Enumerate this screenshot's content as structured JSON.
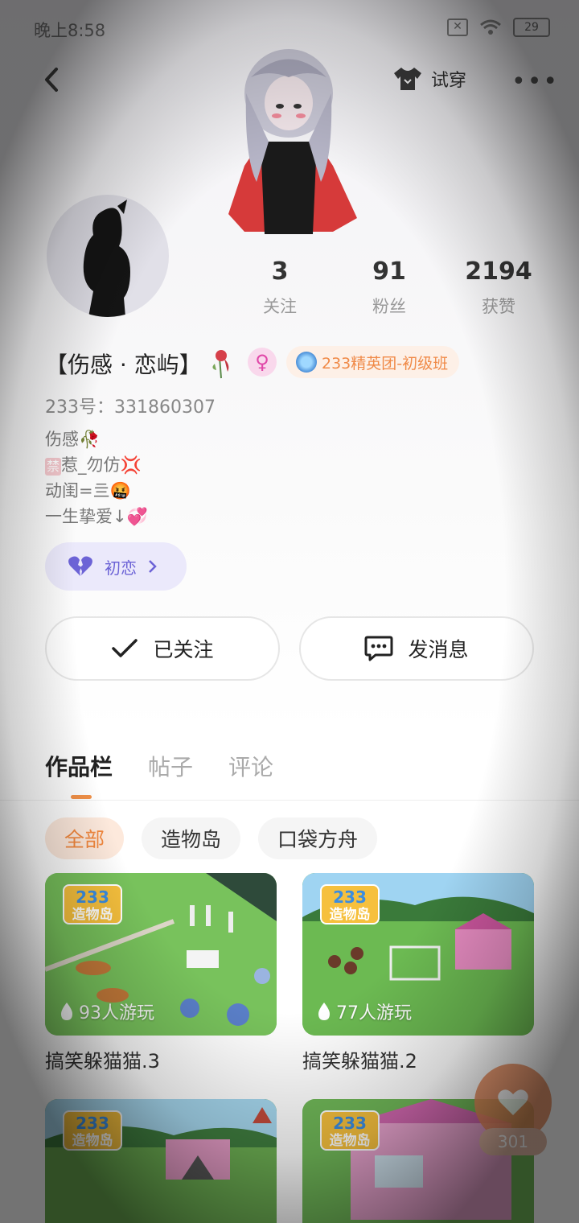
{
  "status_bar": {
    "time": "晚上8:58",
    "battery": "29"
  },
  "header": {
    "try_on_label": "试穿",
    "more_label": "•••"
  },
  "stats": [
    {
      "value": "3",
      "label": "关注"
    },
    {
      "value": "91",
      "label": "粉丝"
    },
    {
      "value": "2194",
      "label": "获赞"
    }
  ],
  "profile": {
    "name": "【伤感 · 恋屿】",
    "gender_symbol": "♀",
    "badge_label": "233精英团-初级班",
    "uid": "233号：331860307",
    "bio_lines": [
      "伤感🥀",
      "惹_勿仿💢",
      "动闺=亖🤬",
      "一生挚爱↓💞"
    ],
    "bio_tag": "禁",
    "relation_label": "初恋"
  },
  "actions": {
    "follow_label": "已关注",
    "message_label": "发消息"
  },
  "tabs": [
    {
      "label": "作品栏"
    },
    {
      "label": "帖子"
    },
    {
      "label": "评论"
    }
  ],
  "filters": [
    {
      "label": "全部"
    },
    {
      "label": "造物岛"
    },
    {
      "label": "口袋方舟"
    }
  ],
  "works": [
    {
      "title": "搞笑躲猫猫.3",
      "plays": "93人游玩"
    },
    {
      "title": "搞笑躲猫猫.2",
      "plays": "77人游玩"
    },
    {
      "title": "",
      "plays": ""
    },
    {
      "title": "",
      "plays": ""
    }
  ],
  "logo": {
    "top": "233",
    "bottom": "造物岛"
  },
  "like_fab": {
    "count": "301"
  },
  "colors": {
    "accent": "#f2883e",
    "purple": "#6c63d6",
    "pink": "#e048a8"
  }
}
